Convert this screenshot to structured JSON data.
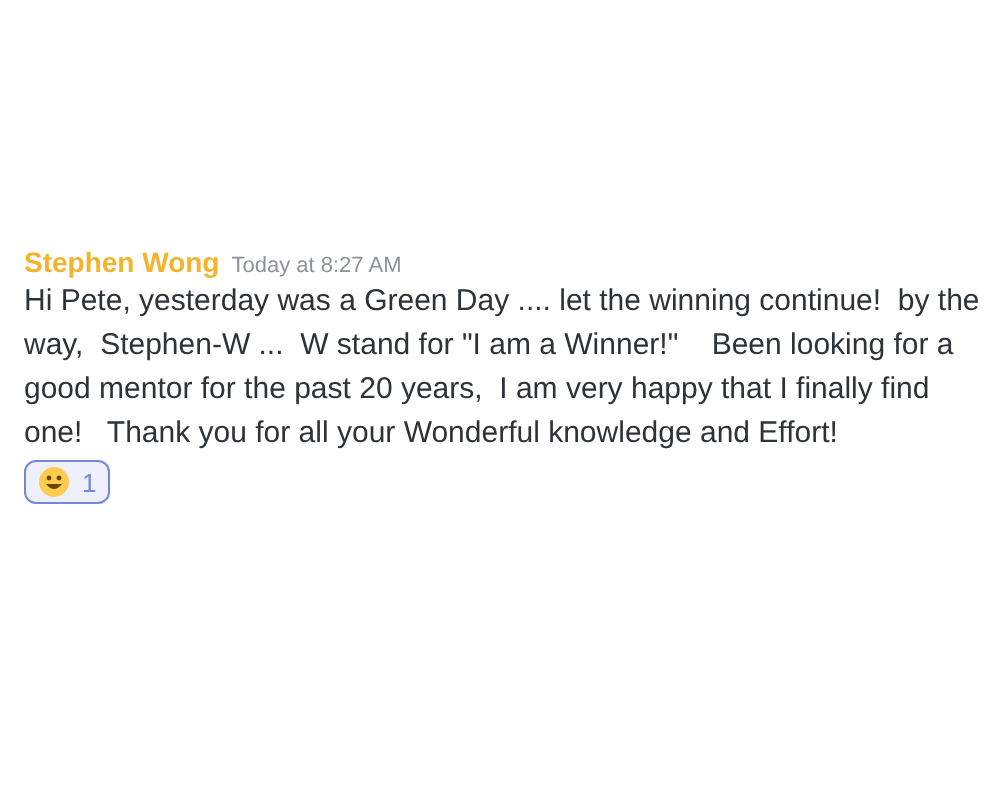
{
  "message": {
    "author": "Stephen Wong",
    "timestamp": "Today at 8:27 AM",
    "text": "Hi Pete, yesterday was a Green Day .... let the winning continue!  by the way,  Stephen-W ...  W stand for \"I am a Winner!\"    Been looking for a good mentor for the past 20 years,  I am very happy that I finally find one!   Thank you for all your Wonderful knowledge and Effort!",
    "reactions": [
      {
        "count": "1",
        "reacted": true
      }
    ]
  }
}
